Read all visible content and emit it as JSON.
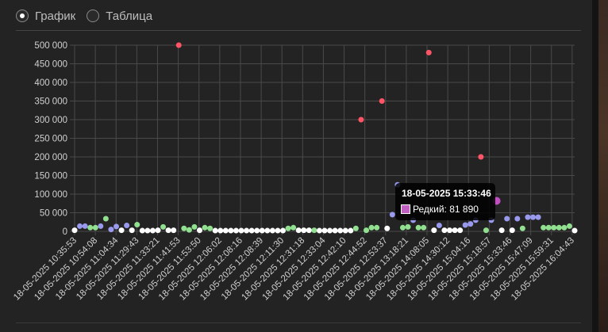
{
  "view_toggle": {
    "options": [
      {
        "label": "График",
        "checked": true
      },
      {
        "label": "Таблица",
        "checked": false
      }
    ]
  },
  "chart_data": {
    "type": "scatter",
    "ylim": [
      0,
      500000
    ],
    "yticks": [
      "0",
      "50 000",
      "100 000",
      "150 000",
      "200 000",
      "250 000",
      "300 000",
      "350 000",
      "400 000",
      "450 000",
      "500 000"
    ],
    "xticks": [
      "18-05-2025 10:35:53",
      "18-05-2025 10:54:08",
      "18-05-2025 11:04:34",
      "18-05-2025 11:29:43",
      "18-05-2025 11:33:21",
      "18-05-2025 11:41:53",
      "18-05-2025 11:53:50",
      "18-05-2025 12:06:02",
      "18-05-2025 12:08:16",
      "18-05-2025 12:08:39",
      "18-05-2025 12:11:30",
      "18-05-2025 12:31:18",
      "18-05-2025 12:33:04",
      "18-05-2025 12:42:10",
      "18-05-2025 12:44:52",
      "18-05-2025 12:53:37",
      "18-05-2025 13:18:21",
      "18-05-2025 14:08:05",
      "18-05-2025 14:30:12",
      "18-05-2025 15:04:16",
      "18-05-2025 15:18:57",
      "18-05-2025 15:33:46",
      "18-05-2025 15:47:09",
      "18-05-2025 15:59:31",
      "18-05-2025 16:04:43"
    ],
    "n_points": 96,
    "colors": {
      "white": "#ffffff",
      "green": "#90e090",
      "blue": "#9999ee",
      "red": "#ff5566",
      "magenta": "#c050c0"
    },
    "points": [
      {
        "i": 0,
        "v": 3000,
        "c": "white"
      },
      {
        "i": 1,
        "v": 14000,
        "c": "blue"
      },
      {
        "i": 2,
        "v": 14000,
        "c": "blue"
      },
      {
        "i": 3,
        "v": 10000,
        "c": "green"
      },
      {
        "i": 4,
        "v": 10000,
        "c": "green"
      },
      {
        "i": 5,
        "v": 14000,
        "c": "blue"
      },
      {
        "i": 6,
        "v": 34000,
        "c": "green"
      },
      {
        "i": 7,
        "v": 5000,
        "c": "blue"
      },
      {
        "i": 8,
        "v": 13000,
        "c": "blue"
      },
      {
        "i": 9,
        "v": 3000,
        "c": "white"
      },
      {
        "i": 10,
        "v": 16000,
        "c": "blue"
      },
      {
        "i": 11,
        "v": 3000,
        "c": "white"
      },
      {
        "i": 12,
        "v": 18000,
        "c": "green"
      },
      {
        "i": 13,
        "v": 2000,
        "c": "white"
      },
      {
        "i": 14,
        "v": 2000,
        "c": "white"
      },
      {
        "i": 15,
        "v": 2000,
        "c": "white"
      },
      {
        "i": 16,
        "v": 3000,
        "c": "white"
      },
      {
        "i": 17,
        "v": 12000,
        "c": "green"
      },
      {
        "i": 18,
        "v": 3000,
        "c": "white"
      },
      {
        "i": 19,
        "v": 3000,
        "c": "white"
      },
      {
        "i": 20,
        "v": 500000,
        "c": "red"
      },
      {
        "i": 21,
        "v": 8000,
        "c": "green"
      },
      {
        "i": 22,
        "v": 4000,
        "c": "green"
      },
      {
        "i": 23,
        "v": 12000,
        "c": "green"
      },
      {
        "i": 24,
        "v": 3000,
        "c": "white"
      },
      {
        "i": 25,
        "v": 10000,
        "c": "green"
      },
      {
        "i": 26,
        "v": 8000,
        "c": "green"
      },
      {
        "i": 27,
        "v": 2000,
        "c": "white"
      },
      {
        "i": 28,
        "v": 2000,
        "c": "white"
      },
      {
        "i": 29,
        "v": 2000,
        "c": "white"
      },
      {
        "i": 30,
        "v": 2000,
        "c": "white"
      },
      {
        "i": 31,
        "v": 2000,
        "c": "white"
      },
      {
        "i": 32,
        "v": 2000,
        "c": "white"
      },
      {
        "i": 33,
        "v": 2000,
        "c": "white"
      },
      {
        "i": 34,
        "v": 2000,
        "c": "white"
      },
      {
        "i": 35,
        "v": 2000,
        "c": "white"
      },
      {
        "i": 36,
        "v": 2000,
        "c": "white"
      },
      {
        "i": 37,
        "v": 2000,
        "c": "white"
      },
      {
        "i": 38,
        "v": 2000,
        "c": "white"
      },
      {
        "i": 39,
        "v": 2000,
        "c": "white"
      },
      {
        "i": 40,
        "v": 2000,
        "c": "white"
      },
      {
        "i": 41,
        "v": 8000,
        "c": "green"
      },
      {
        "i": 42,
        "v": 10000,
        "c": "green"
      },
      {
        "i": 43,
        "v": 3000,
        "c": "white"
      },
      {
        "i": 44,
        "v": 3000,
        "c": "white"
      },
      {
        "i": 45,
        "v": 3000,
        "c": "white"
      },
      {
        "i": 46,
        "v": 3000,
        "c": "green"
      },
      {
        "i": 47,
        "v": 2000,
        "c": "white"
      },
      {
        "i": 48,
        "v": 2000,
        "c": "white"
      },
      {
        "i": 49,
        "v": 2000,
        "c": "white"
      },
      {
        "i": 50,
        "v": 2000,
        "c": "white"
      },
      {
        "i": 51,
        "v": 2000,
        "c": "white"
      },
      {
        "i": 52,
        "v": 2000,
        "c": "white"
      },
      {
        "i": 53,
        "v": 2000,
        "c": "white"
      },
      {
        "i": 54,
        "v": 8000,
        "c": "green"
      },
      {
        "i": 55,
        "v": 300000,
        "c": "red"
      },
      {
        "i": 56,
        "v": 3000,
        "c": "green"
      },
      {
        "i": 57,
        "v": 10000,
        "c": "green"
      },
      {
        "i": 58,
        "v": 10000,
        "c": "green"
      },
      {
        "i": 59,
        "v": 350000,
        "c": "red"
      },
      {
        "i": 60,
        "v": 8000,
        "c": "white"
      },
      {
        "i": 61,
        "v": 45000,
        "c": "blue"
      },
      {
        "i": 62,
        "v": 125000,
        "c": "blue"
      },
      {
        "i": 63,
        "v": 10000,
        "c": "green"
      },
      {
        "i": 64,
        "v": 12000,
        "c": "green"
      },
      {
        "i": 65,
        "v": 30000,
        "c": "blue"
      },
      {
        "i": 66,
        "v": 10000,
        "c": "green"
      },
      {
        "i": 67,
        "v": 10000,
        "c": "green"
      },
      {
        "i": 68,
        "v": 480000,
        "c": "red"
      },
      {
        "i": 69,
        "v": 3000,
        "c": "white"
      },
      {
        "i": 70,
        "v": 16000,
        "c": "blue"
      },
      {
        "i": 71,
        "v": 3000,
        "c": "white"
      },
      {
        "i": 72,
        "v": 3000,
        "c": "white"
      },
      {
        "i": 73,
        "v": 3000,
        "c": "white"
      },
      {
        "i": 74,
        "v": 3000,
        "c": "white"
      },
      {
        "i": 75,
        "v": 17000,
        "c": "blue"
      },
      {
        "i": 76,
        "v": 20000,
        "c": "blue"
      },
      {
        "i": 77,
        "v": 30000,
        "c": "blue"
      },
      {
        "i": 78,
        "v": 200000,
        "c": "red"
      },
      {
        "i": 79,
        "v": 3000,
        "c": "green"
      },
      {
        "i": 80,
        "v": 30000,
        "c": "blue"
      },
      {
        "i": 81,
        "v": 81890,
        "c": "magenta"
      },
      {
        "i": 82,
        "v": 3000,
        "c": "white"
      },
      {
        "i": 83,
        "v": 34000,
        "c": "blue"
      },
      {
        "i": 84,
        "v": 3000,
        "c": "white"
      },
      {
        "i": 85,
        "v": 34000,
        "c": "blue"
      },
      {
        "i": 86,
        "v": 8000,
        "c": "green"
      },
      {
        "i": 87,
        "v": 38000,
        "c": "blue"
      },
      {
        "i": 88,
        "v": 38000,
        "c": "blue"
      },
      {
        "i": 89,
        "v": 38000,
        "c": "blue"
      },
      {
        "i": 90,
        "v": 10000,
        "c": "green"
      },
      {
        "i": 91,
        "v": 10000,
        "c": "green"
      },
      {
        "i": 92,
        "v": 10000,
        "c": "green"
      },
      {
        "i": 93,
        "v": 10000,
        "c": "green"
      },
      {
        "i": 94,
        "v": 10000,
        "c": "green"
      },
      {
        "i": 95,
        "v": 14000,
        "c": "green"
      },
      {
        "i": 96,
        "v": 2000,
        "c": "white"
      }
    ],
    "highlighted": {
      "i": 81
    }
  },
  "tooltip": {
    "title": "18-05-2025 15:33:46",
    "label": "Редкий: 81 890"
  }
}
